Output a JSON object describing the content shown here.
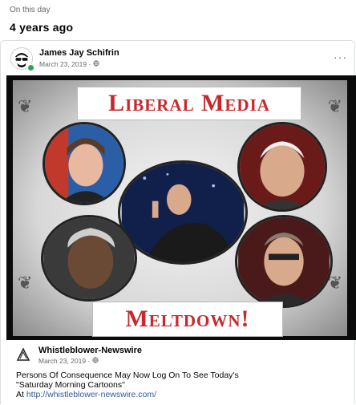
{
  "memory": {
    "label": "On this day",
    "years": "4 years ago"
  },
  "post": {
    "author": "James Jay Schifrin",
    "date": "March 23, 2019 ·",
    "privacy_icon": "globe-icon",
    "more_label": "···"
  },
  "image": {
    "title_top": "Liberal Media",
    "title_bottom": "Meltdown!"
  },
  "shared": {
    "source": "Whistleblower-Newswire",
    "date": "March 23, 2019 ·",
    "line1": "Persons Of Consequence May Now Log On To See Today's",
    "line2": "\"Saturday Morning Cartoons\"",
    "line3_prefix": "At ",
    "link": "http://whistleblower-newswire.com/"
  },
  "colors": {
    "accent_red": "#c8282c",
    "link_blue": "#385898",
    "online_green": "#31a24c"
  }
}
